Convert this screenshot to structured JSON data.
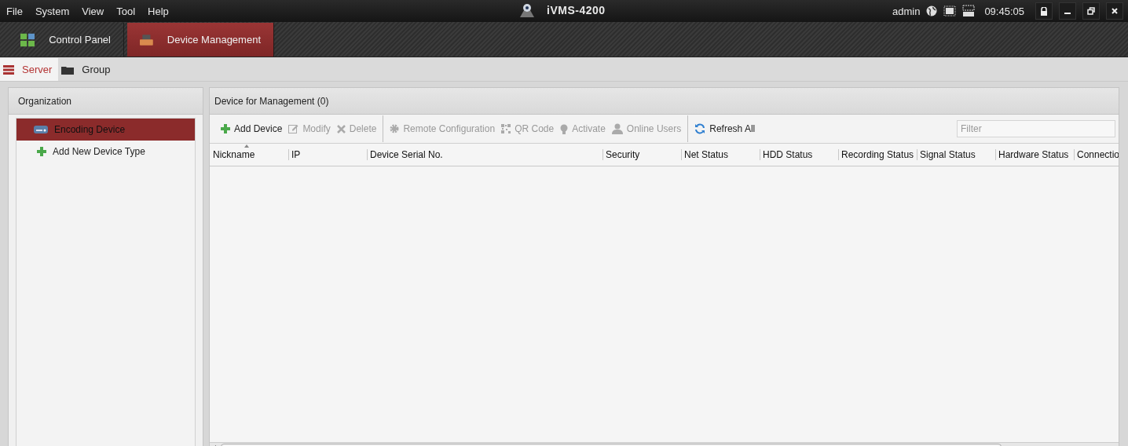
{
  "menu": [
    "File",
    "System",
    "View",
    "Tool",
    "Help"
  ],
  "app_title": "iVMS-4200",
  "user": "admin",
  "clock": "09:45:05",
  "module_tabs": [
    {
      "label": "Control Panel",
      "selected": false
    },
    {
      "label": "Device Management",
      "selected": true
    }
  ],
  "sub_tabs": [
    {
      "label": "Server",
      "selected": true
    },
    {
      "label": "Group",
      "selected": false
    }
  ],
  "organization": {
    "title": "Organization",
    "items": [
      {
        "label": "Encoding Device",
        "selected": true
      },
      {
        "label": "Add New Device Type",
        "selected": false
      }
    ]
  },
  "device_panel": {
    "title": "Device for Management (0)",
    "toolbar": [
      {
        "kind": "button",
        "label": "Add Device",
        "disabled": false
      },
      {
        "kind": "button",
        "label": "Modify",
        "disabled": true
      },
      {
        "kind": "button",
        "label": "Delete",
        "disabled": true
      },
      {
        "kind": "separator"
      },
      {
        "kind": "button",
        "label": "Remote Configuration",
        "disabled": true
      },
      {
        "kind": "button",
        "label": "QR Code",
        "disabled": true
      },
      {
        "kind": "button",
        "label": "Activate",
        "disabled": true
      },
      {
        "kind": "button",
        "label": "Online Users",
        "disabled": true
      },
      {
        "kind": "separator"
      },
      {
        "kind": "button",
        "label": "Refresh All",
        "disabled": false
      }
    ],
    "filter": {
      "placeholder": "Filter"
    },
    "columns": [
      {
        "label": "Nickname",
        "sorted": true
      },
      {
        "label": "IP",
        "sorted": false
      },
      {
        "label": "Device Serial No.",
        "sorted": false
      },
      {
        "label": "Security",
        "sorted": false
      },
      {
        "label": "Net Status",
        "sorted": false
      },
      {
        "label": "HDD Status",
        "sorted": false
      },
      {
        "label": "Recording Status",
        "sorted": false
      },
      {
        "label": "Signal Status",
        "sorted": false
      },
      {
        "label": "Hardware Status",
        "sorted": false
      },
      {
        "label": "Connectio",
        "sorted": false
      }
    ]
  }
}
